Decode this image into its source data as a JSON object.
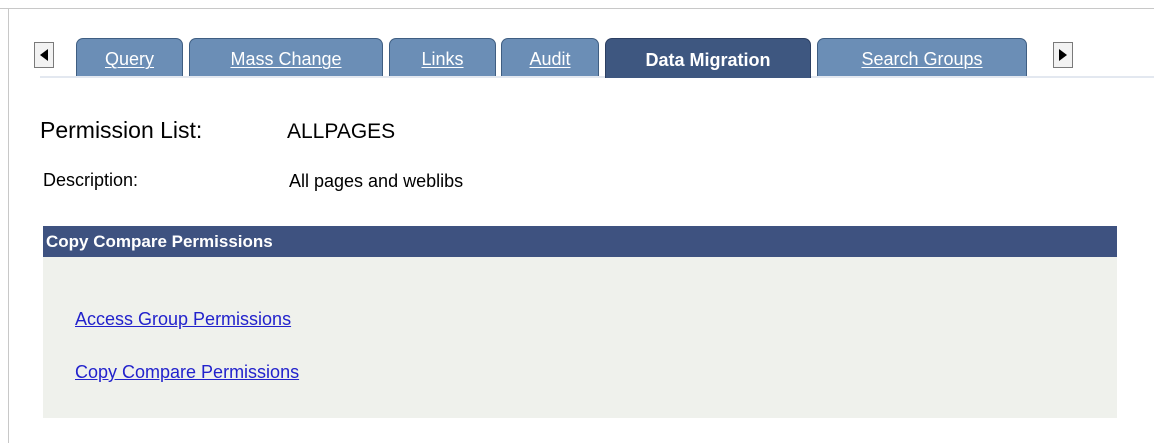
{
  "tabs": {
    "items": [
      {
        "prefix": "",
        "accel": "Q",
        "rest": "uery"
      },
      {
        "prefix": "",
        "accel": "M",
        "rest": "ass Change"
      },
      {
        "prefix": "",
        "accel": "L",
        "rest": "inks"
      },
      {
        "prefix": "",
        "accel": "A",
        "rest": "udit"
      },
      {
        "prefix": "Data Migration",
        "accel": "",
        "rest": ""
      },
      {
        "prefix": "Search ",
        "accel": "G",
        "rest": "roups"
      }
    ],
    "active": "Data Migration",
    "scroll_left_icon": "triangle-left",
    "scroll_right_icon": "triangle-right"
  },
  "header": {
    "permission_list_label": "Permission List:",
    "permission_list_value": "ALLPAGES",
    "description_label": "Description:",
    "description_value": "All pages and weblibs"
  },
  "group": {
    "title": "Copy Compare Permissions",
    "links": [
      "Access Group Permissions",
      "Copy Compare Permissions"
    ]
  },
  "colors": {
    "tab_bg": "#6b8eb6",
    "tab_active_bg": "#3e5780",
    "group_header_bg": "#3e5280",
    "group_body_bg": "#eff1ec",
    "link": "#2222cc"
  }
}
